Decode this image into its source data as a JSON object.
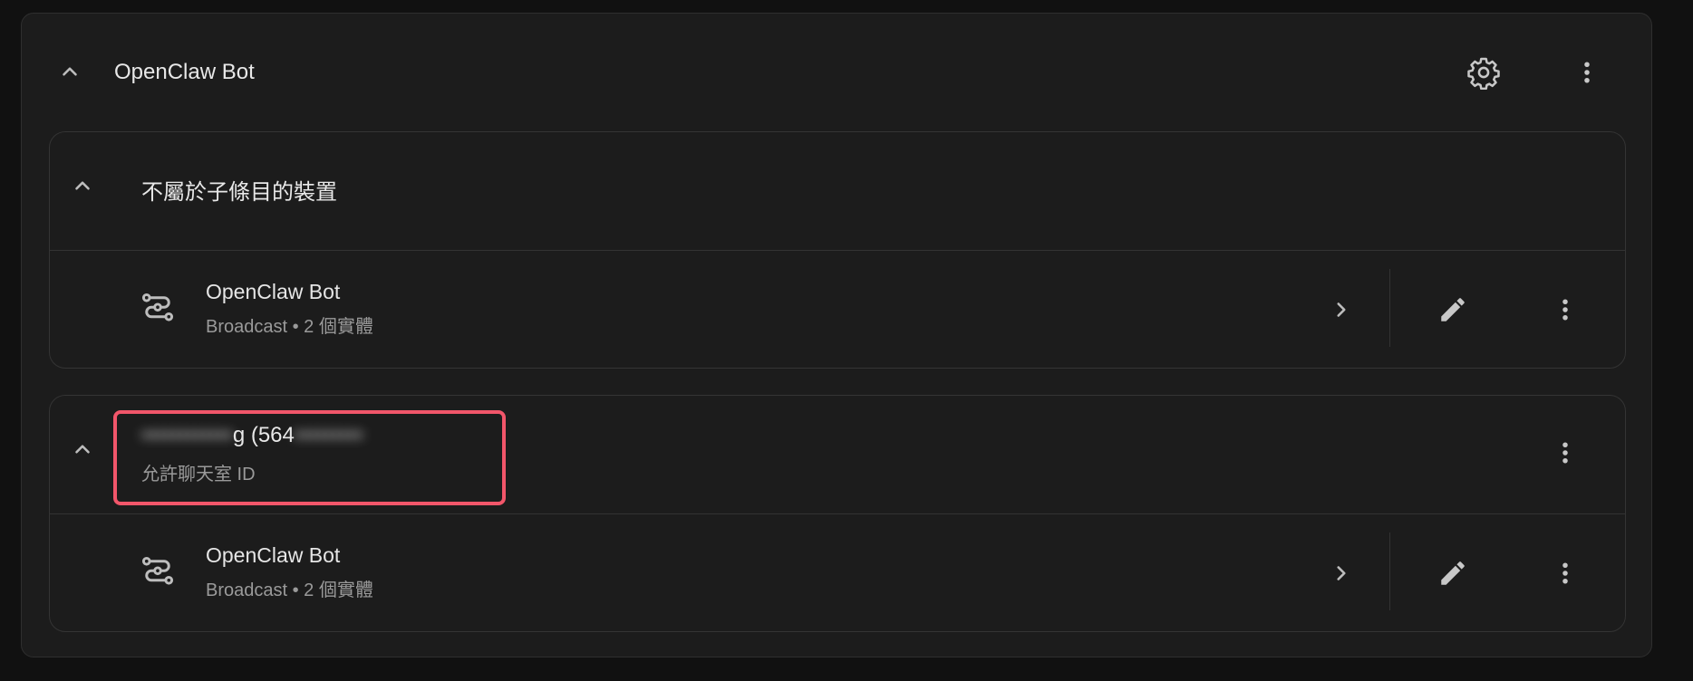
{
  "integration": {
    "title": "OpenClaw Bot",
    "icons": {
      "collapse": "chevron-up-icon",
      "settings": "gear-icon",
      "menu": "more-vert-icon"
    }
  },
  "groups": [
    {
      "title": "不屬於子條目的裝置",
      "subtitle": "",
      "items": [
        {
          "title": "OpenClaw Bot",
          "subtitle": "Broadcast • 2 個實體"
        }
      ]
    },
    {
      "title_visible": "g (564",
      "title_blurred_prefix": "••••••••••••",
      "title_blurred_suffix": "•••••••••",
      "subtitle": "允許聊天室 ID",
      "items": [
        {
          "title": "OpenClaw Bot",
          "subtitle": "Broadcast • 2 個實體"
        }
      ]
    }
  ],
  "colors": {
    "background": "#111111",
    "card": "#1c1c1c",
    "highlight": "#f2566a"
  }
}
